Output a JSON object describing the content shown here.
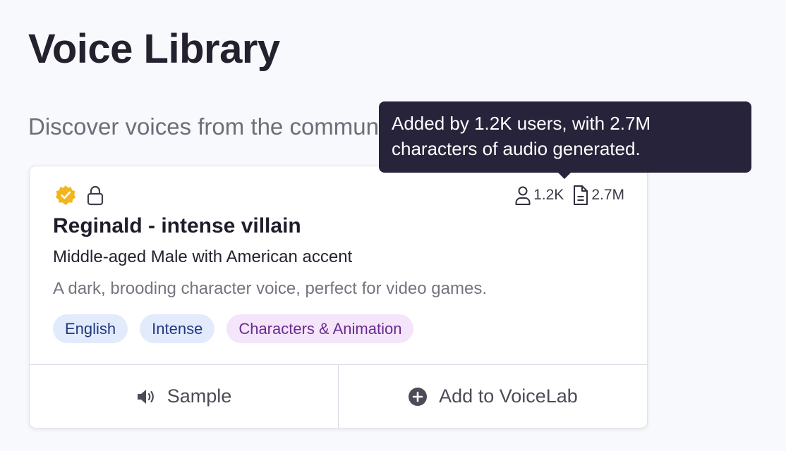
{
  "page": {
    "title": "Voice Library",
    "subtitle": "Discover voices from the community"
  },
  "voice_card": {
    "icons": [
      "verified-badge-icon",
      "lock-icon"
    ],
    "stats": {
      "users_icon": "user-icon",
      "users": "1.2K",
      "characters_icon": "document-icon",
      "characters": "2.7M"
    },
    "name": "Reginald - intense villain",
    "meta": "Middle-aged Male with American accent",
    "description": "A dark, brooding character voice, perfect for video games.",
    "tags": [
      {
        "label": "English",
        "color": "#e1ebfc"
      },
      {
        "label": "Intense",
        "color": "#e1ebfc"
      },
      {
        "label": "Characters & Animation",
        "color": "#f4e5fa"
      }
    ],
    "actions": {
      "sample_icon": "speaker-icon",
      "sample_label": "Sample",
      "add_icon": "plus-circle-icon",
      "add_label": "Add to VoiceLab"
    }
  },
  "tooltip": {
    "line1": "Added by 1.2K users, with 2.7M",
    "line2": "characters of audio generated."
  },
  "colors": {
    "background": "#f8f9fc",
    "verified": "#f2b51c",
    "tooltip_bg": "#26233a",
    "tag_blue": "#e1ebfc",
    "tag_purple": "#f4e5fa"
  }
}
